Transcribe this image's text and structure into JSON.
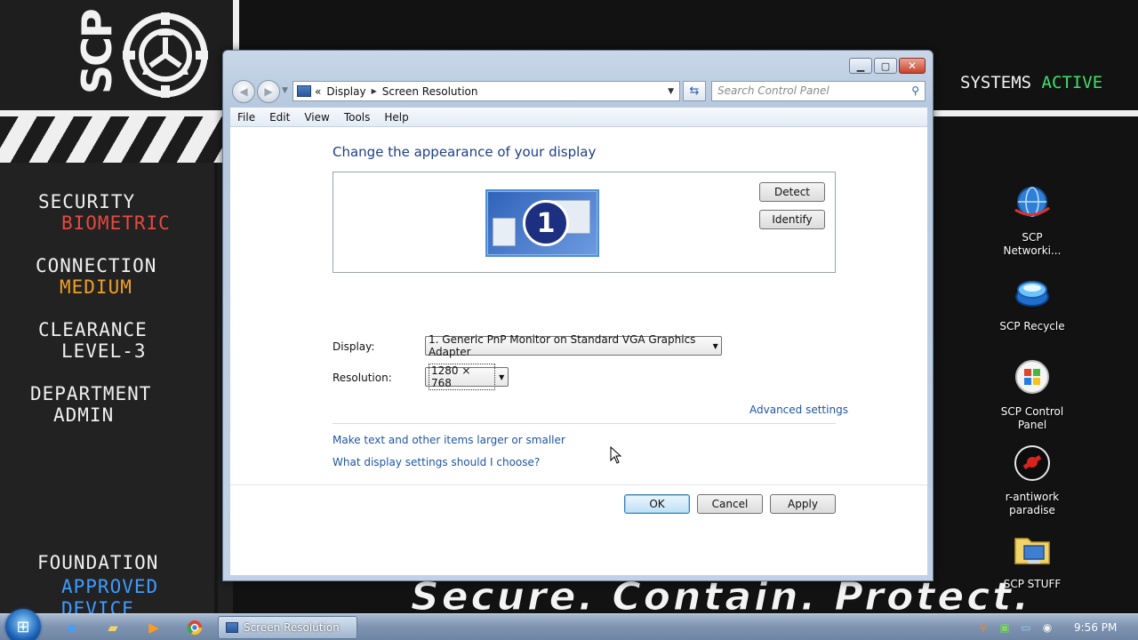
{
  "wallpaper": {
    "logo_text": "SCP",
    "status": {
      "left": "SYSTEMS",
      "right": "ACTIVE"
    },
    "motto": "Secure. Contain. Protect.",
    "side_blocks": [
      {
        "label": "SECURITY",
        "value": "BIOMETRIC"
      },
      {
        "label": "CONNECTION",
        "value": "MEDIUM"
      },
      {
        "label": "CLEARANCE",
        "value": "LEVEL-3"
      },
      {
        "label": "DEPARTMENT",
        "value": "ADMIN"
      },
      {
        "label": "FOUNDATION",
        "value": "APPROVED",
        "extra": "DEVICE"
      }
    ]
  },
  "desktop_icons": [
    {
      "label": "SCP Networki...",
      "icon": "network-globe-icon"
    },
    {
      "label": "SCP Recycle",
      "icon": "recycle-bin-icon"
    },
    {
      "label": "SCP Control Panel",
      "icon": "control-panel-icon"
    },
    {
      "label": "r-antiwork paradise",
      "icon": "antiwork-logo-icon"
    },
    {
      "label": "SCP STUFF",
      "icon": "folder-computer-icon"
    }
  ],
  "window": {
    "address": {
      "root": "«",
      "segments": [
        "Display",
        "Screen Resolution"
      ]
    },
    "search_placeholder": "Search Control Panel",
    "menu": [
      "File",
      "Edit",
      "View",
      "Tools",
      "Help"
    ],
    "heading": "Change the appearance of your display",
    "monitor_number": "1",
    "detect_label": "Detect",
    "identify_label": "Identify",
    "display_label": "Display:",
    "display_value": "1. Generic PnP Monitor on Standard VGA Graphics Adapter",
    "resolution_label": "Resolution:",
    "resolution_value": "1280 × 768",
    "advanced_link": "Advanced settings",
    "links": [
      "Make text and other items larger or smaller",
      "What display settings should I choose?"
    ],
    "ok_label": "OK",
    "cancel_label": "Cancel",
    "apply_label": "Apply"
  },
  "taskbar": {
    "task_label": "Screen Resolution",
    "clock": "9:56 PM"
  },
  "colors": {
    "accent_red": "#e4493f",
    "accent_orange": "#f0a020",
    "accent_blue": "#3f9bff",
    "accent_green": "#3ee06a",
    "link_blue": "#1e55a8"
  }
}
